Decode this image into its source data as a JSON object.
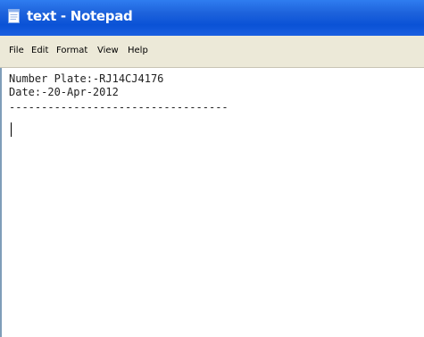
{
  "window": {
    "title": "text - Notepad"
  },
  "menu": {
    "items": [
      "File",
      "Edit",
      "Format",
      "View",
      "Help"
    ]
  },
  "document": {
    "lines": [
      "Number Plate:-RJ14CJ4176",
      "Date:-20-Apr-2012",
      "----------------------------------"
    ]
  }
}
